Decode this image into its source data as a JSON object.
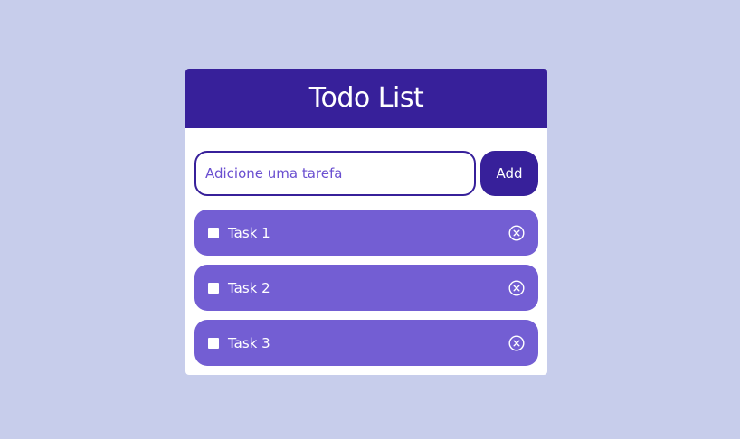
{
  "colors": {
    "page_background": "#c7cdeb",
    "primary": "#37209a",
    "task_background": "#735ed3",
    "card_background": "#ffffff"
  },
  "header": {
    "title": "Todo List"
  },
  "input": {
    "value": "",
    "placeholder": "Adicione uma tarefa"
  },
  "add_button": {
    "label": "Add"
  },
  "tasks": [
    {
      "label": "Task 1",
      "checked": false,
      "delete_icon": "close-circle-icon"
    },
    {
      "label": "Task 2",
      "checked": false,
      "delete_icon": "close-circle-icon"
    },
    {
      "label": "Task 3",
      "checked": false,
      "delete_icon": "close-circle-icon"
    }
  ]
}
